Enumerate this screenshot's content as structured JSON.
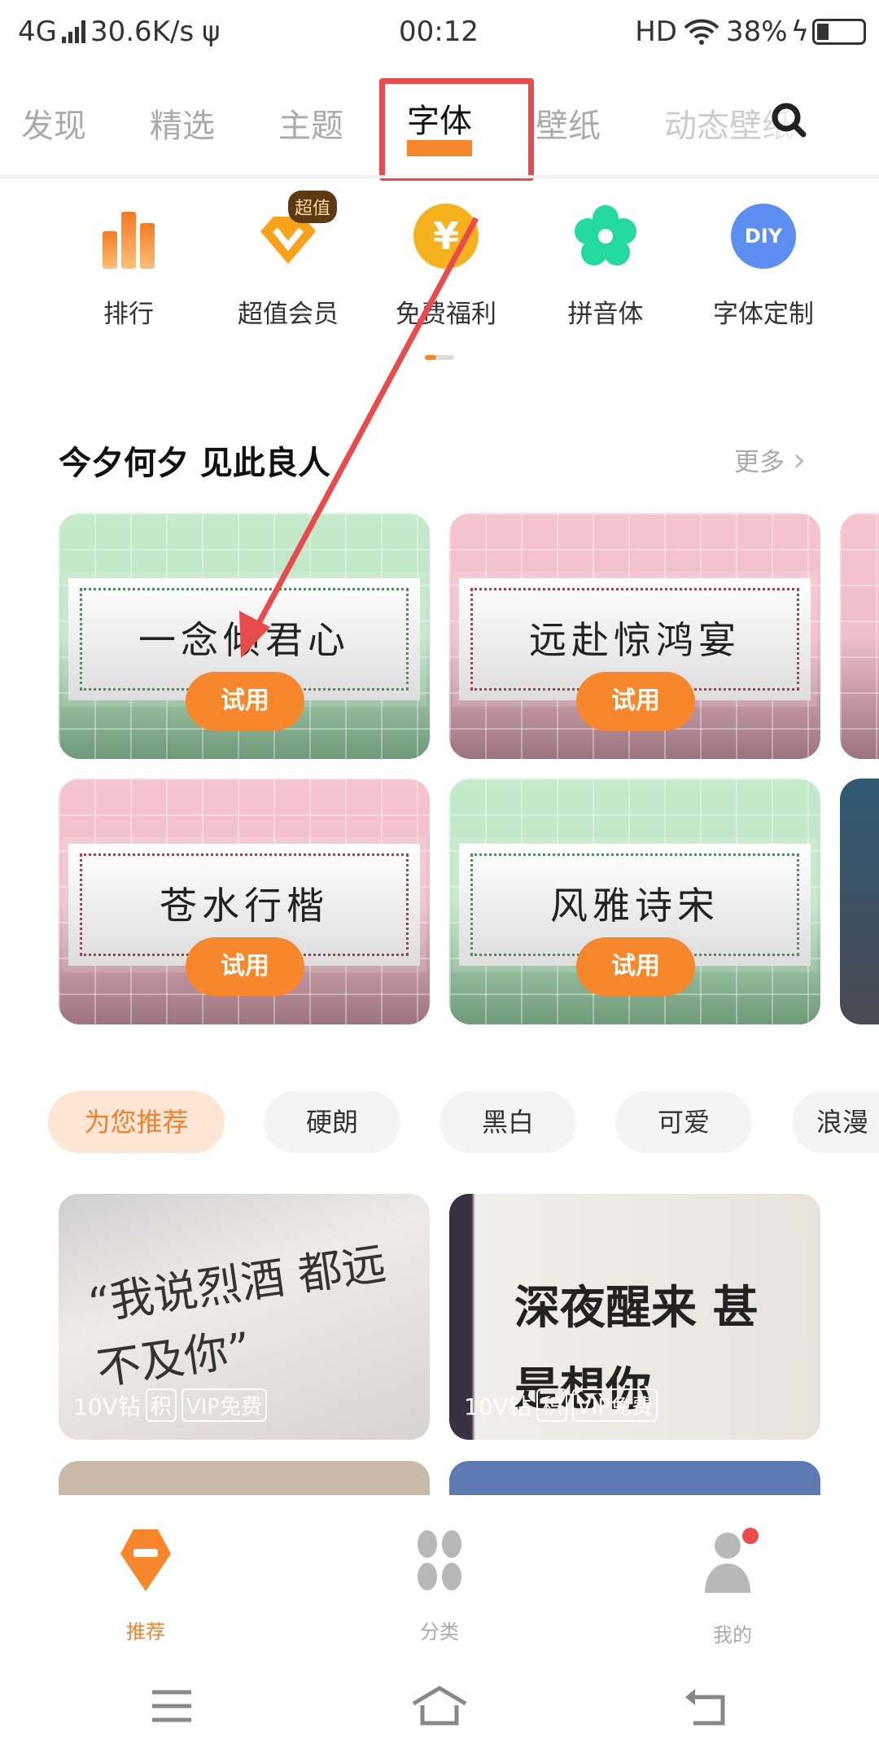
{
  "status_bar": {
    "network": "4G",
    "speed": "30.6K/s",
    "time": "00:12",
    "hd": "HD",
    "battery": "38%"
  },
  "top_tabs": [
    {
      "label": "发现"
    },
    {
      "label": "精选"
    },
    {
      "label": "主题"
    },
    {
      "label": "字体",
      "active": true
    },
    {
      "label": "壁纸"
    },
    {
      "label": "动态壁纸"
    }
  ],
  "quick_entries": [
    {
      "label": "排行",
      "icon": "bar-chart-icon"
    },
    {
      "label": "超值会员",
      "icon": "vip-icon",
      "badge": "超值"
    },
    {
      "label": "免费福利",
      "icon": "yen-coin-icon"
    },
    {
      "label": "拼音体",
      "icon": "flower-icon"
    },
    {
      "label": "字体定制",
      "icon": "diy-icon",
      "icon_text": "DIY"
    }
  ],
  "section": {
    "title": "今夕何夕 见此良人",
    "more": "更多"
  },
  "font_cards": [
    {
      "text": "一念倾君心",
      "theme": "green",
      "button": "试用"
    },
    {
      "text": "远赴惊鸿宴",
      "theme": "pink",
      "button": "试用"
    },
    {
      "text": "苍水行楷",
      "theme": "pink",
      "button": "试用"
    },
    {
      "text": "风雅诗宋",
      "theme": "green",
      "button": "试用"
    }
  ],
  "chips": [
    {
      "label": "为您推荐",
      "active": true
    },
    {
      "label": "硬朗"
    },
    {
      "label": "黑白"
    },
    {
      "label": "可爱"
    },
    {
      "label": "浪漫"
    }
  ],
  "recommend": [
    {
      "image_text": "“我说烈酒 都远不及你”",
      "price": "10V钻",
      "tag1": "积",
      "tag2": "VIP免费"
    },
    {
      "image_text": "深夜醒来 甚是想你",
      "price": "10V钻",
      "tag1": "积",
      "tag2": "VIP免费"
    }
  ],
  "bottom_nav": [
    {
      "label": "推荐",
      "active": true
    },
    {
      "label": "分类"
    },
    {
      "label": "我的"
    }
  ],
  "colors": {
    "accent": "#f8862a",
    "annotation": "#e94b4b"
  }
}
